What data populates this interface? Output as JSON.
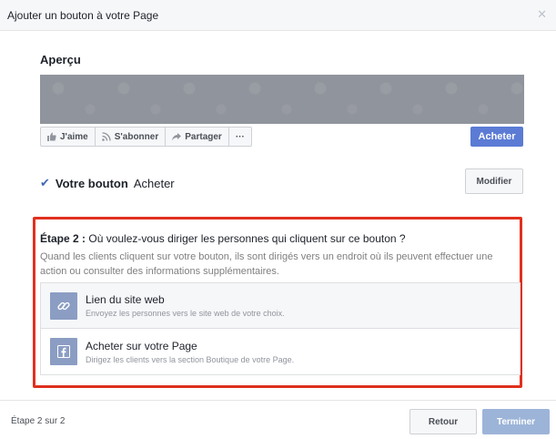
{
  "dialog": {
    "title": "Ajouter un bouton à votre Page",
    "close_icon": "close-icon"
  },
  "preview": {
    "label": "Aperçu",
    "actions": [
      {
        "label": "J'aime",
        "icon": "thumbs-up-icon"
      },
      {
        "label": "S'abonner",
        "icon": "rss-icon"
      },
      {
        "label": "Partager",
        "icon": "share-arrow-icon"
      },
      {
        "label": "···",
        "icon": "more-icon"
      }
    ],
    "cta_label": "Acheter"
  },
  "your_button": {
    "prefix": "Votre bouton",
    "value": "Acheter",
    "modify_label": "Modifier"
  },
  "step": {
    "label": "Étape 2 :",
    "question": "Où voulez-vous diriger les personnes qui cliquent sur ce bouton ?",
    "description": "Quand les clients cliquent sur votre bouton, ils sont dirigés vers un endroit où ils peuvent effectuer une action ou consulter des informations supplémentaires.",
    "options": [
      {
        "title": "Lien du site web",
        "subtitle": "Envoyez les personnes vers le site web de votre choix.",
        "icon": "link-icon"
      },
      {
        "title": "Acheter sur votre Page",
        "subtitle": "Dirigez les clients vers la section Boutique de votre Page.",
        "icon": "facebook-icon"
      }
    ]
  },
  "footer": {
    "step_count": "Étape 2 sur 2",
    "back_label": "Retour",
    "finish_label": "Terminer"
  },
  "colors": {
    "accent": "#5b7bd5",
    "highlight_border": "#e0301e",
    "disabled_button": "#9cb4d8"
  }
}
